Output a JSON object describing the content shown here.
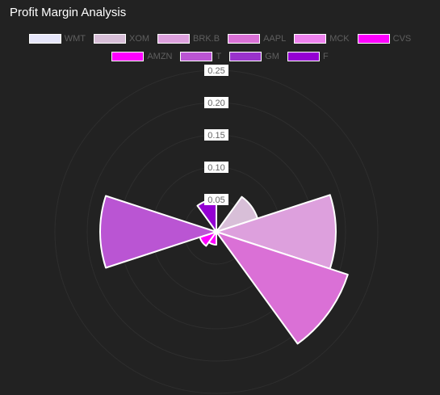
{
  "chart_data": {
    "type": "polar-area",
    "title": "Profit Margin Analysis",
    "categories": [
      "WMT",
      "XOM",
      "BRK.B",
      "AAPL",
      "MCK",
      "CVS",
      "AMZN",
      "T",
      "GM",
      "F"
    ],
    "values": [
      0.004,
      0.067,
      0.185,
      0.214,
      0.002,
      0.02,
      0.027,
      0.18,
      0.004,
      0.05
    ],
    "colors": [
      "#e6e6fa",
      "#d8bfd8",
      "#dda0dd",
      "#da70d6",
      "#ee82ee",
      "#ff00ff",
      "#ff00ff",
      "#ba55d3",
      "#9932cc",
      "#9400d3"
    ],
    "radial_axis": {
      "min": 0,
      "max": 0.25,
      "ticks": [
        "0.05",
        "0.10",
        "0.15",
        "0.20",
        "0.25"
      ]
    },
    "grid": true,
    "legend_position": "top"
  }
}
